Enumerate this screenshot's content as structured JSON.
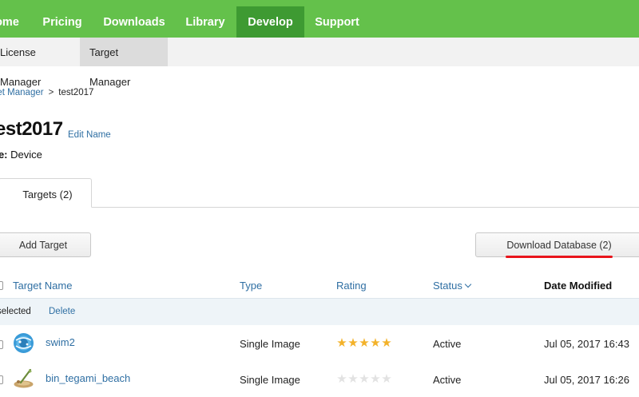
{
  "topnav": {
    "items": [
      {
        "label": "ome",
        "active": false
      },
      {
        "label": "Pricing",
        "active": false
      },
      {
        "label": "Downloads",
        "active": false
      },
      {
        "label": "Library",
        "active": false
      },
      {
        "label": "Develop",
        "active": true
      },
      {
        "label": "Support",
        "active": false
      }
    ],
    "bg_color": "#64c14b",
    "active_color": "#3e9a32"
  },
  "subnav": {
    "items": [
      {
        "label": "License Manager",
        "active": false
      },
      {
        "label": "Target Manager",
        "active": true
      }
    ]
  },
  "breadcrumb": {
    "parent": "get Manager",
    "separator": ">",
    "current": "test2017"
  },
  "page": {
    "title": "est2017",
    "edit_name": "Edit Name",
    "type_label": "pe:",
    "type_value": "Device"
  },
  "tabs": [
    {
      "label": "Targets (2)",
      "active": true
    }
  ],
  "buttons": {
    "add_target": "Add Target",
    "download_database": "Download Database (2)"
  },
  "table": {
    "headers": {
      "name": "Target Name",
      "type": "Type",
      "rating": "Rating",
      "status": "Status",
      "date": "Date Modified"
    },
    "selection": {
      "text": "selected",
      "delete": "Delete"
    },
    "rows": [
      {
        "name": "swim2",
        "type": "Single Image",
        "rating": 5,
        "status": "Active",
        "date": "Jul 05, 2017 16:43",
        "thumb": "swim-thumbnail-icon"
      },
      {
        "name": "bin_tegami_beach",
        "type": "Single Image",
        "rating": 0,
        "status": "Active",
        "date": "Jul 05, 2017 16:26",
        "thumb": "beach-thumbnail-icon"
      }
    ]
  },
  "colors": {
    "link": "#2f6fa3",
    "star_on": "#f3b22a",
    "star_off": "#e2e2e2",
    "highlight": "#e8141b"
  }
}
